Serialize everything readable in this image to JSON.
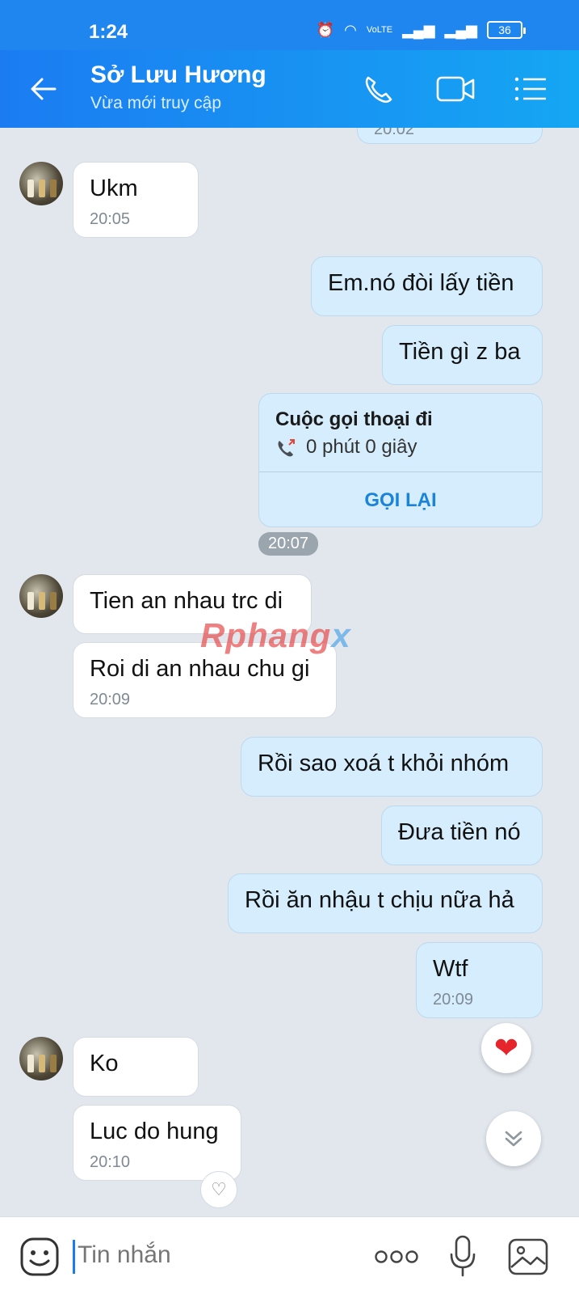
{
  "status_bar": {
    "time": "1:24",
    "battery": "36",
    "network": "VoLTE"
  },
  "header": {
    "title": "Sở Lưu Hương",
    "subtitle": "Vừa mới truy cập"
  },
  "partial_top_time": "20:02",
  "messages": [
    {
      "text": "Ukm",
      "time": "20:05"
    },
    {
      "text": "Em.nó đòi lấy tiền"
    },
    {
      "text": "Tiền gì z ba"
    },
    {
      "text": "Tien an nhau trc di"
    },
    {
      "text": "Roi di an nhau chu gi",
      "time": "20:09"
    },
    {
      "text": "Rồi sao xoá t khỏi nhóm"
    },
    {
      "text": "Đưa tiền nó"
    },
    {
      "text": "Rồi ăn nhậu t chịu nữa hả"
    },
    {
      "text": "Wtf",
      "time": "20:09"
    },
    {
      "text": "Ko"
    },
    {
      "text": "Luc do hung",
      "time": "20:10"
    }
  ],
  "call_card": {
    "title": "Cuộc gọi thoại đi",
    "duration": "0 phút 0 giây",
    "action": "GỌI LẠI"
  },
  "time_chip": "20:07",
  "watermark": {
    "main": "Rphang",
    "accent": "x"
  },
  "composer": {
    "placeholder": "Tin nhắn"
  },
  "icons": [
    "back-arrow-icon",
    "phone-icon",
    "video-icon",
    "menu-icon",
    "heart-icon",
    "chevron-down-icon",
    "emoji-icon",
    "more-dots-icon",
    "mic-icon",
    "image-icon"
  ]
}
